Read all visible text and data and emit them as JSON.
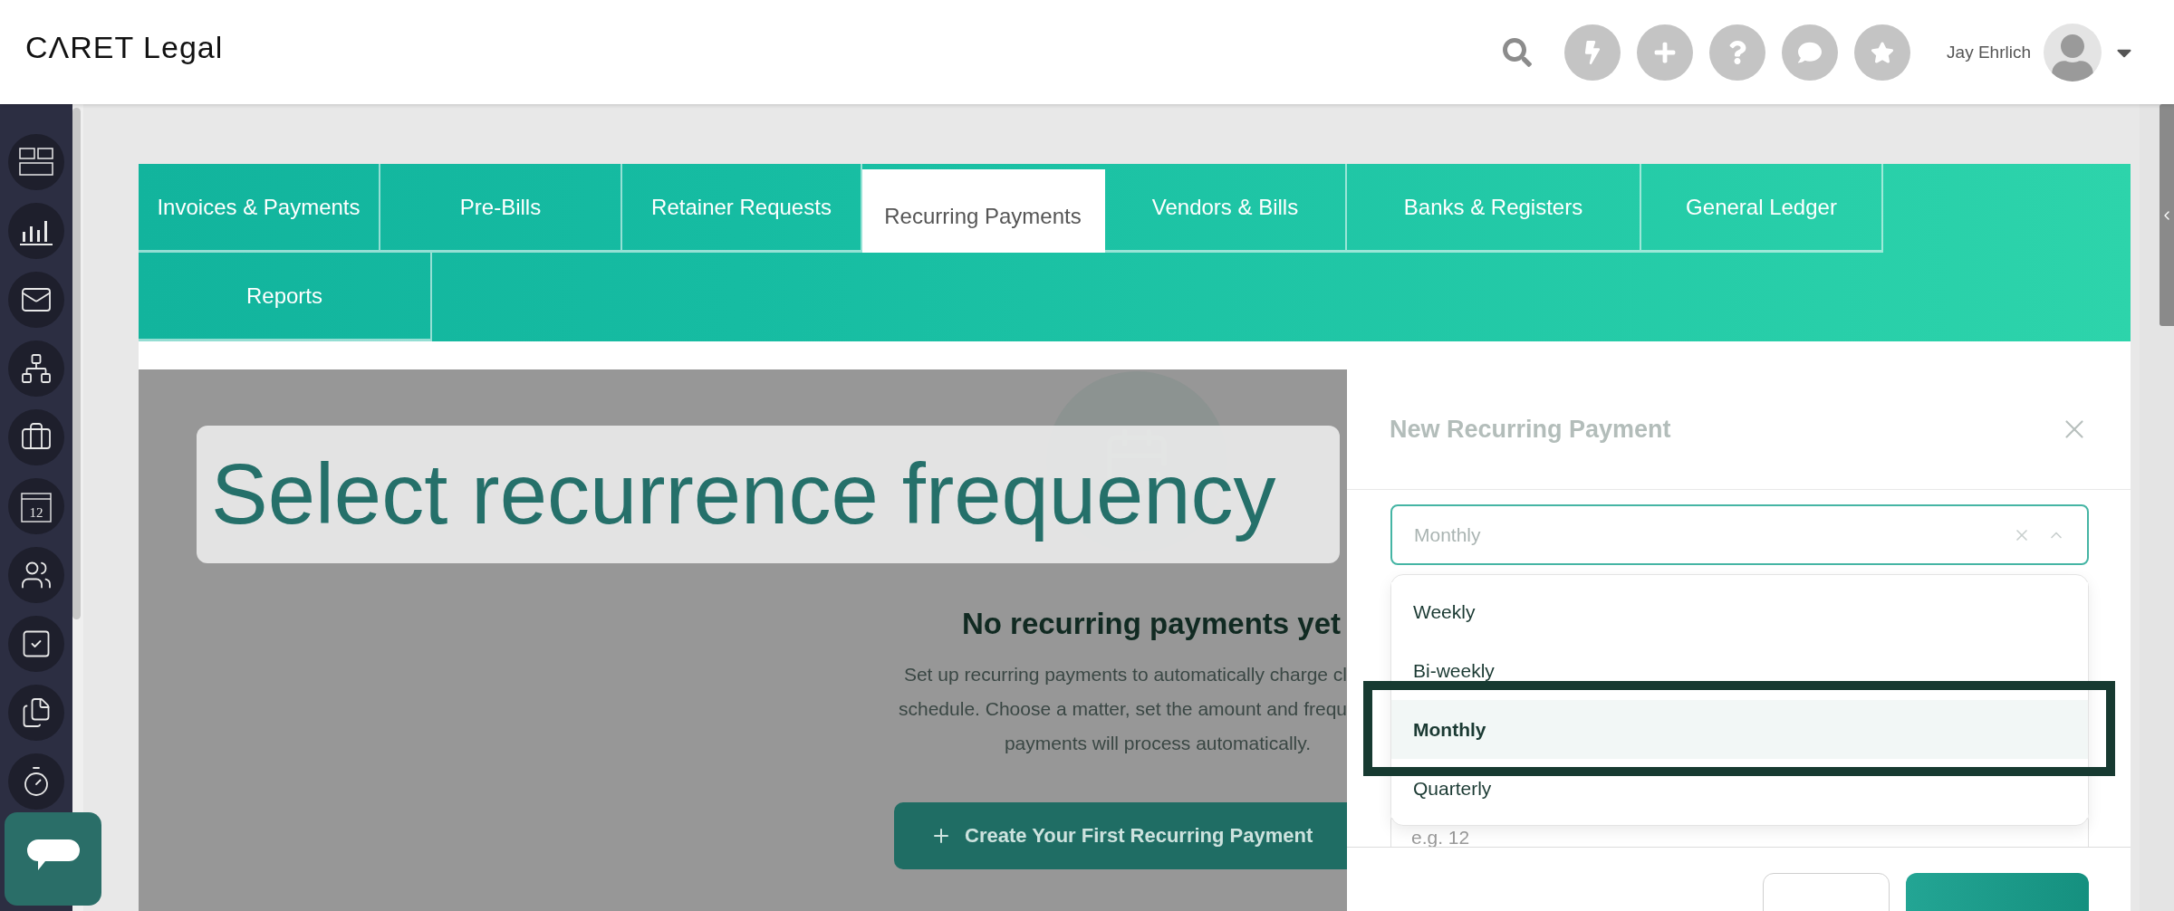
{
  "header": {
    "logo": "CΛRET Legal",
    "user_name": "Jay Ehrlich"
  },
  "sidebar": {
    "items": [
      {
        "kind": "dashboard"
      },
      {
        "kind": "reports"
      },
      {
        "kind": "mail"
      },
      {
        "kind": "network"
      },
      {
        "kind": "matters"
      },
      {
        "kind": "calendar",
        "label": "12"
      },
      {
        "kind": "contacts"
      },
      {
        "kind": "tasks"
      },
      {
        "kind": "documents"
      },
      {
        "kind": "billing"
      }
    ]
  },
  "tabs": {
    "rows": [
      {
        "items": [
          {
            "label": "Invoices & Payments",
            "selected": false
          },
          {
            "label": "Pre-Bills",
            "selected": false
          },
          {
            "label": "Retainer Requests",
            "selected": false
          },
          {
            "label": "Recurring Payments",
            "selected": true
          },
          {
            "label": "Vendors & Bills",
            "selected": false
          },
          {
            "label": "Banks & Registers",
            "selected": false
          },
          {
            "label": "General Ledger",
            "selected": false
          }
        ]
      },
      {
        "items": [
          {
            "label": "Reports",
            "selected": false
          }
        ]
      }
    ]
  },
  "empty_state": {
    "heading": "No recurring payments yet",
    "description_lines": [
      "Set up recurring payments to automatically charge cl",
      "schedule. Choose a matter, set the amount and frequ",
      "payments will process automatically."
    ],
    "button": "Create Your First Recurring Payment"
  },
  "drawer": {
    "title": "New Recurring Payment",
    "frequency_select": {
      "placeholder": "Monthly"
    },
    "options": [
      {
        "label": "Weekly",
        "selected": false
      },
      {
        "label": "Bi-weekly",
        "selected": false
      },
      {
        "label": "Monthly",
        "selected": true
      },
      {
        "label": "Quarterly",
        "selected": false
      }
    ],
    "count_field": {
      "placeholder": "e.g. 12"
    }
  },
  "caption": "Select recurrence frequency"
}
